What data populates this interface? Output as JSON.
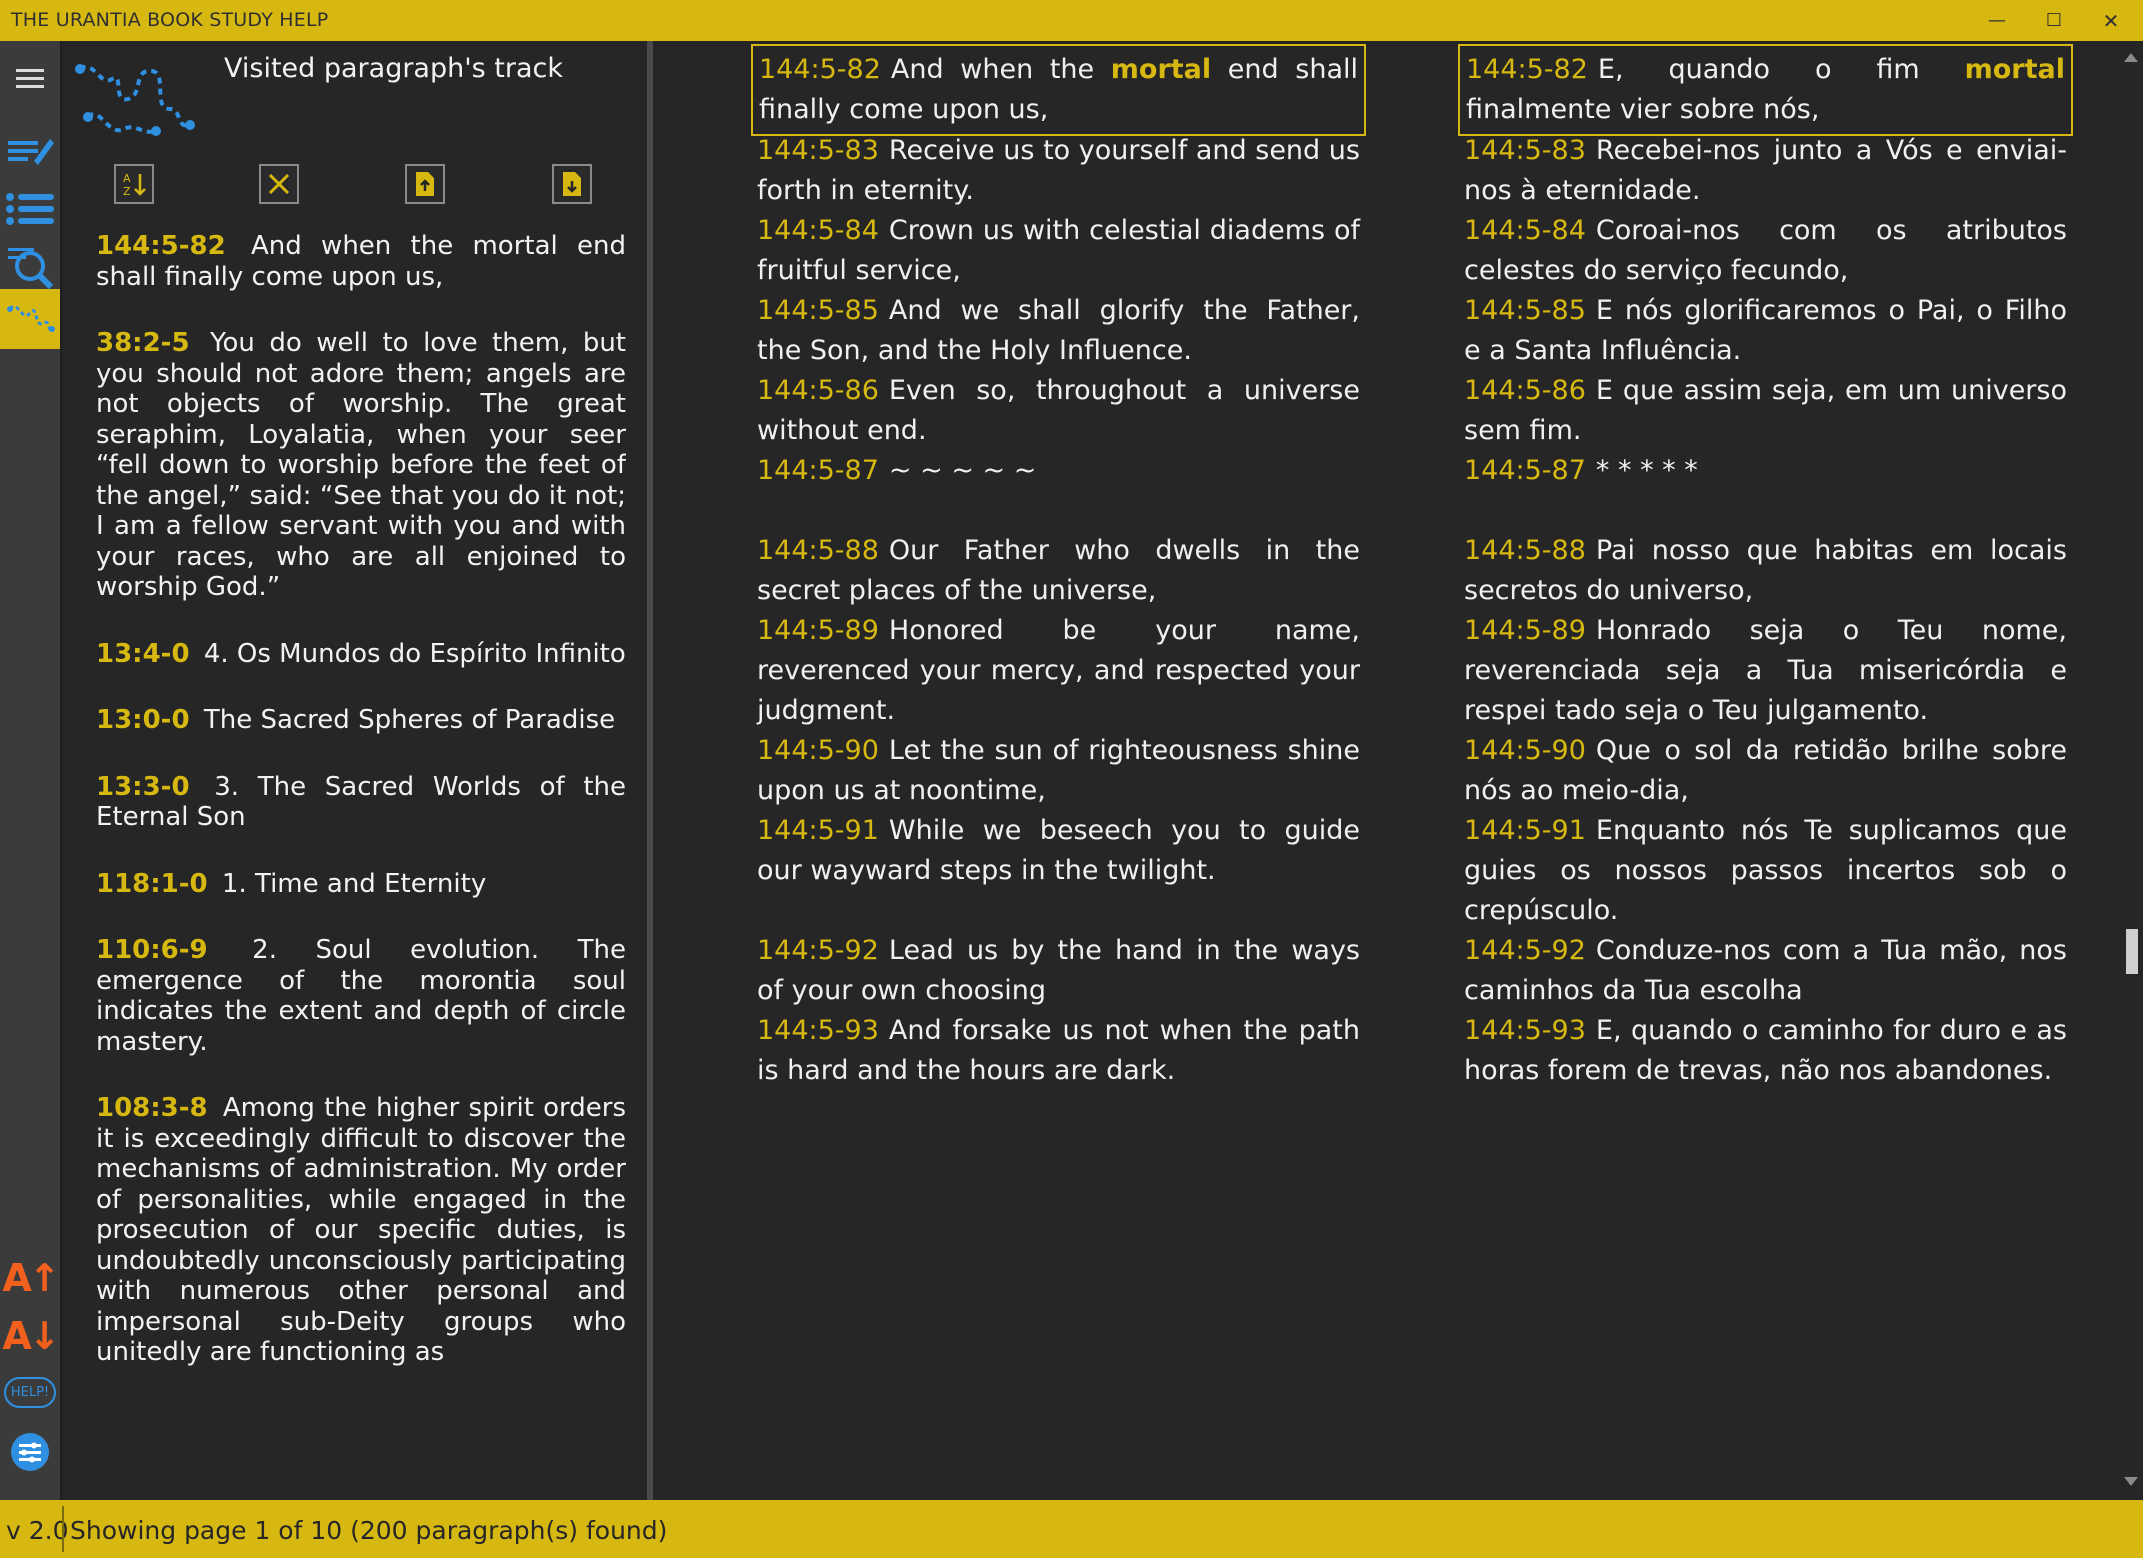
{
  "app": {
    "title": "THE URANTIA BOOK STUDY HELP",
    "minimize_label": "—",
    "maximize_label": "☐",
    "close_label": "✕"
  },
  "iconbar": {
    "icons": [
      "menu-icon",
      "notes-icon",
      "list-icon",
      "search-icon",
      "track-icon",
      "font-increase-icon",
      "font-decrease-icon",
      "help-icon",
      "settings-icon"
    ],
    "font_increase_label": "A↑",
    "font_decrease_label": "A↓",
    "help_label": "HELP!"
  },
  "track": {
    "title": "Visited paragraph's track",
    "tool_icons": [
      "sort-icon",
      "clear-icon",
      "export-up-icon",
      "export-down-icon"
    ],
    "items": [
      {
        "ref": "144:5-82",
        "text": "And when the mortal end shall finally come upon us,"
      },
      {
        "ref": "38:2-5",
        "text": "You do well to love them, but you should not adore them; angels are not objects of worship. The great seraphim, Loyalatia, when your seer “fell down to worship before the feet of the angel,” said: “See that you do it not; I am a fellow servant with you and with your races, who are all enjoined to worship God.”"
      },
      {
        "ref": "13:4-0",
        "text": "4. Os Mundos do Espírito Infinito"
      },
      {
        "ref": "13:0-0",
        "text": "The Sacred Spheres of Paradise"
      },
      {
        "ref": "13:3-0",
        "text": "3. The Sacred Worlds of the Eternal Son"
      },
      {
        "ref": "118:1-0",
        "text": "1. Time and Eternity"
      },
      {
        "ref": "110:6-9",
        "text": "2. Soul evolution. The emergence of the morontia soul indicates the extent and depth of circle mastery."
      },
      {
        "ref": "108:3-8",
        "text": "Among the higher spirit orders it is exceedingly difficult to discover the mechanisms of administration. My order of personalities, while engaged in the prosecution of our specific duties, is undoubtedly unconsciously participating with numerous other personal and impersonal sub-Deity groups who unitedly are functioning as"
      }
    ]
  },
  "main": {
    "highlight_word_en": "mortal",
    "highlight_word_pt": "mortal",
    "paragraphs": [
      {
        "ref": "144:5-82",
        "en_pre": "And when the ",
        "en_hl": "mortal",
        "en_post": " end shall finally come upon us,",
        "pt_pre": "E, quando o fim ",
        "pt_hl": "mortal",
        "pt_post": " finalmente vier sobre nós,"
      },
      {
        "ref": "144:5-83",
        "en": "Receive us to yourself and send us forth in eternity.",
        "pt": "Recebei-nos junto a Vós e enviai-nos à eternidade."
      },
      {
        "ref": "144:5-84",
        "en": "Crown us with celestial diadems of fruitful service,",
        "pt": "Coroai-nos com os atributos celestes do serviço fecundo,"
      },
      {
        "ref": "144:5-85",
        "en": "And we shall glorify the Father, the Son, and the Holy Influence.",
        "pt": "E nós glorificaremos o Pai, o Filho e a Santa Influência."
      },
      {
        "ref": "144:5-86",
        "en": "Even so, throughout a universe without end.",
        "pt": "E que assim seja, em um universo sem fim."
      },
      {
        "ref": "144:5-87",
        "en": "~ ~ ~ ~ ~",
        "pt": "* * * * *"
      },
      {
        "ref": "144:5-88",
        "en": "Our Father who dwells in the secret places of the universe,",
        "pt": "Pai nosso que habitas em locais secretos do universo,"
      },
      {
        "ref": "144:5-89",
        "en": "Honored be your name, reverenced your mercy, and respected your judgment.",
        "pt": "Honrado seja o Teu nome, reverenciada seja a Tua misericórdia e respei tado seja o Teu julgamento."
      },
      {
        "ref": "144:5-90",
        "en": "Let the sun of righteousness shine upon us at noontime,",
        "pt": "Que o sol da retidão brilhe sobre nós ao meio-dia,"
      },
      {
        "ref": "144:5-91",
        "en": "While we beseech you to guide our wayward steps in the twilight.",
        "pt": "Enquanto nós Te suplicamos que guies os nossos passos incertos sob o crepúsculo."
      },
      {
        "ref": "144:5-92",
        "en": "Lead us by the hand in the ways of your own choosing",
        "pt": "Conduze-nos com a Tua mão, nos caminhos da Tua escolha"
      },
      {
        "ref": "144:5-93",
        "en": "And forsake us not when the path is hard and the hours are dark.",
        "pt": "E, quando o caminho for duro e as horas forem de trevas, não nos abandones."
      }
    ]
  },
  "status": {
    "version": "v 2.0",
    "message": "Showing page 1 of 10 (200 paragraph(s) found)"
  },
  "colors": {
    "accent": "#d7b811",
    "background": "#262626",
    "iconbar": "#3b3b3b",
    "icon_blue": "#2f8fe0",
    "icon_orange": "#f2601e"
  }
}
